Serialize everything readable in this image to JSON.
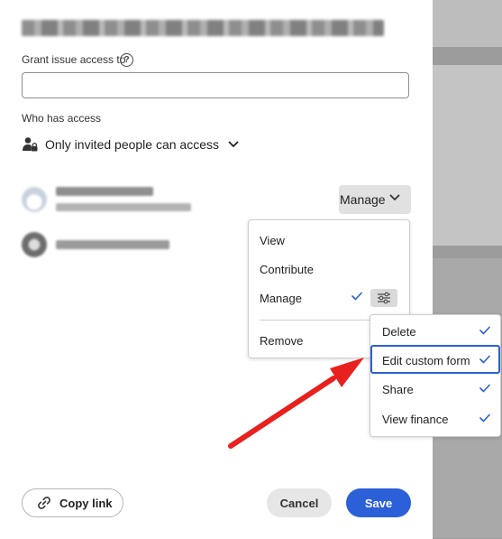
{
  "grant": {
    "label": "Grant issue access to",
    "input_value": "",
    "help_symbol": "?"
  },
  "who": {
    "label": "Who has access",
    "access_mode": "Only invited people can access"
  },
  "people": [
    {
      "role_button": "Manage"
    }
  ],
  "role_menu": {
    "items": [
      "View",
      "Contribute",
      "Manage",
      "Remove"
    ],
    "selected": "Manage"
  },
  "permissions_menu": {
    "items": [
      {
        "label": "Delete",
        "checked": true
      },
      {
        "label": "Edit custom form",
        "checked": true
      },
      {
        "label": "Share",
        "checked": true
      },
      {
        "label": "View finance",
        "checked": true
      }
    ],
    "highlighted": "Edit custom form"
  },
  "footer": {
    "copy_link": "Copy link",
    "cancel": "Cancel",
    "save": "Save"
  },
  "colors": {
    "accent": "#2c60d8",
    "check": "#2c60cc",
    "annotation_arrow": "#e8201e",
    "backdrop": "#9c9c9c"
  },
  "icons": [
    "help-icon",
    "lock-person-icon",
    "chevron-down-icon",
    "checkmark-icon",
    "sliders-icon",
    "link-icon",
    "annotation-arrow"
  ]
}
